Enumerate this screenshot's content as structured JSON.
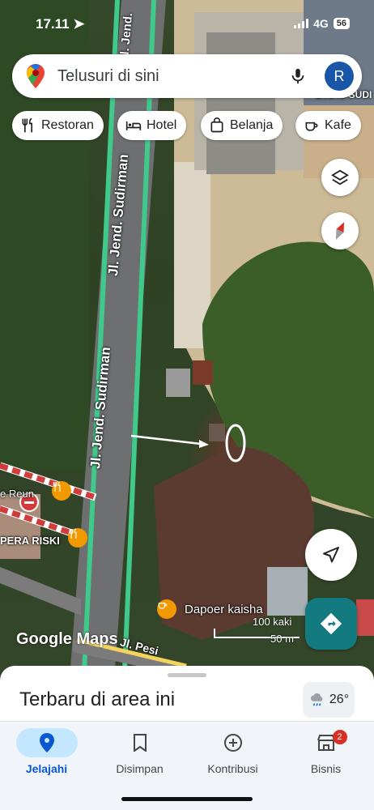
{
  "status_bar": {
    "time": "17.11",
    "network": "4G",
    "battery": "56"
  },
  "search": {
    "placeholder": "Telusuri di sini",
    "avatar_letter": "R"
  },
  "chips": [
    {
      "label": "Restoran",
      "icon": "restaurant-icon"
    },
    {
      "label": "Hotel",
      "icon": "bed-icon"
    },
    {
      "label": "Belanja",
      "icon": "shopping-bag-icon"
    },
    {
      "label": "Kafe",
      "icon": "coffee-icon"
    }
  ],
  "map": {
    "road_labels": [
      "Jl. Jend. Sudirman",
      "Jl. Jend. Sudirman",
      "Jl. Jend.",
      "Jl. Pesi"
    ],
    "places": [
      {
        "name": "Dapoer kaisha",
        "icon": "cafe-icon"
      },
      {
        "name": "PERA RISKI",
        "icon": "restaurant-icon"
      },
      {
        "name": "e Reun",
        "icon": "restaurant-icon"
      }
    ],
    "top_right_label": "DINAS SUDI",
    "scale": {
      "feet": "100 kaki",
      "meters": "50 m"
    },
    "attribution": "Google Maps",
    "colors": {
      "route": "#3fc98a",
      "cafe": "#f29900",
      "navigate": "#137a7f"
    }
  },
  "sheet": {
    "title": "Terbaru di area ini",
    "temperature": "26°"
  },
  "nav": [
    {
      "label": "Jelajahi",
      "icon": "location-pin-icon",
      "active": true
    },
    {
      "label": "Disimpan",
      "icon": "bookmark-icon",
      "active": false
    },
    {
      "label": "Kontribusi",
      "icon": "add-circle-icon",
      "active": false
    },
    {
      "label": "Bisnis",
      "icon": "store-icon",
      "active": false,
      "badge": "2"
    }
  ]
}
